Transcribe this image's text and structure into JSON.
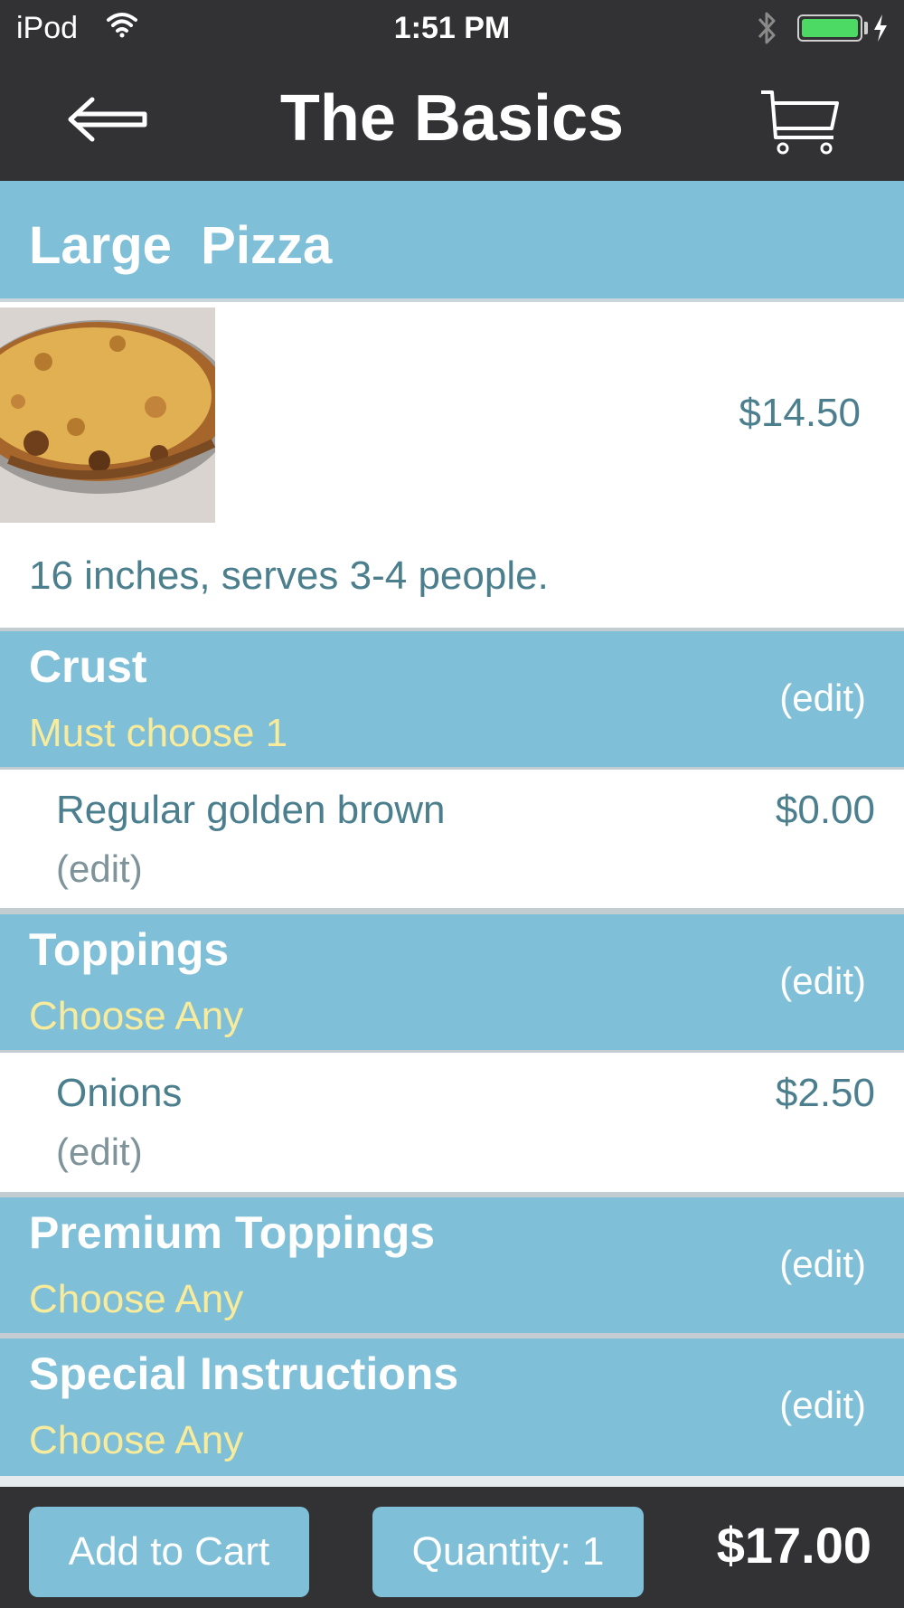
{
  "status_bar": {
    "carrier": "iPod",
    "time": "1:51 PM",
    "battery_level": 1.0,
    "battery_color": "#4cd964"
  },
  "nav": {
    "title": "The Basics",
    "back_icon": "back-arrow-icon",
    "cart_icon": "cart-icon"
  },
  "item": {
    "name": "Large  Pizza",
    "price": "$14.50",
    "description": "16 inches, serves 3-4 people.",
    "image": "pizza-photo"
  },
  "groups": [
    {
      "title": "Crust",
      "subtitle": "Must choose 1",
      "edit": "(edit)",
      "option": {
        "name": "Regular golden brown",
        "price": "$0.00",
        "edit": "(edit)"
      }
    },
    {
      "title": "Toppings",
      "subtitle": "Choose Any",
      "edit": "(edit)",
      "option": {
        "name": "Onions",
        "price": "$2.50",
        "edit": "(edit)"
      }
    },
    {
      "title": "Premium Toppings",
      "subtitle": "Choose Any",
      "edit": "(edit)"
    },
    {
      "title": "Special Instructions",
      "subtitle": "Choose Any",
      "edit": "(edit)"
    }
  ],
  "footer": {
    "add_to_cart": "Add to Cart",
    "quantity": "Quantity: 1",
    "total": "$17.00"
  },
  "colors": {
    "bar": "#323133",
    "accent": "#7fc0d8",
    "subtitle": "#f8eb9b",
    "text": "#4b7f8e"
  }
}
